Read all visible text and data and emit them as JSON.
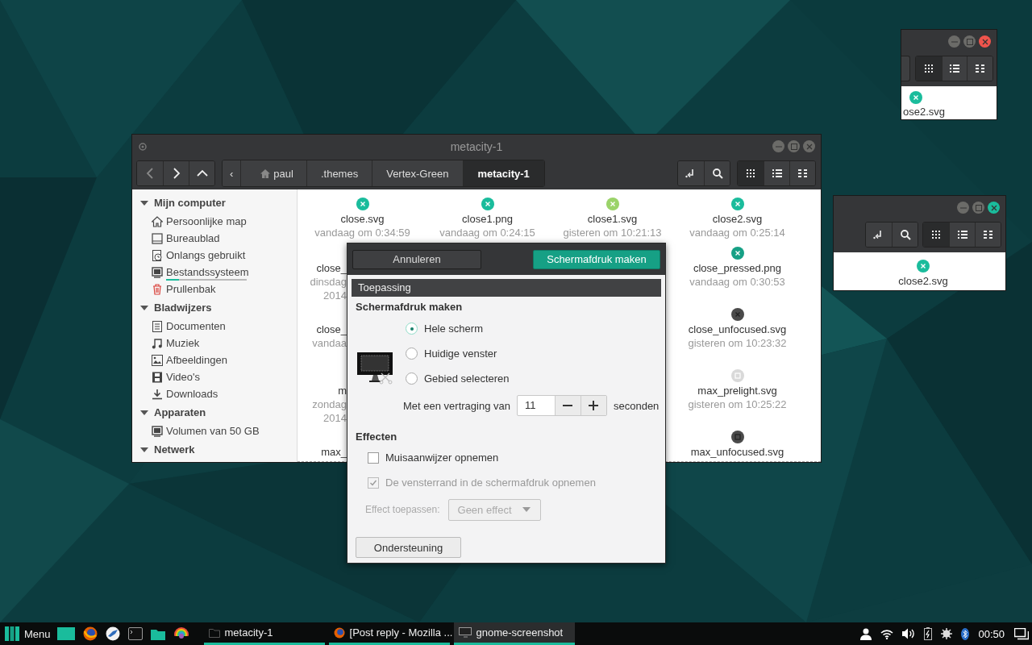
{
  "file_manager": {
    "title": "metacity-1",
    "breadcrumbs": [
      {
        "label": "‹",
        "kind": "scroll",
        "selected": false
      },
      {
        "label": "paul",
        "kind": "home",
        "selected": false
      },
      {
        "label": ".themes",
        "kind": "folder",
        "selected": false
      },
      {
        "label": "Vertex-Green",
        "kind": "folder",
        "selected": false
      },
      {
        "label": "metacity-1",
        "kind": "folder",
        "selected": true
      }
    ],
    "view_modes": [
      {
        "kind": "icons",
        "selected": true
      },
      {
        "kind": "list",
        "selected": false
      },
      {
        "kind": "compact",
        "selected": false
      }
    ],
    "sidebar": [
      {
        "title": "Mijn computer",
        "expanded": true,
        "items": [
          {
            "label": "Persoonlijke map",
            "kind": "home"
          },
          {
            "label": "Bureaublad",
            "kind": "desktop"
          },
          {
            "label": "Onlangs gebruikt",
            "kind": "recent"
          },
          {
            "label": "Bestandssysteem",
            "kind": "drive",
            "usage": {
              "level": 0.16
            }
          },
          {
            "label": "Prullenbak",
            "kind": "trash"
          }
        ]
      },
      {
        "title": "Bladwijzers",
        "expanded": true,
        "items": [
          {
            "label": "Documenten",
            "kind": "documents"
          },
          {
            "label": "Muziek",
            "kind": "music"
          },
          {
            "label": "Afbeeldingen",
            "kind": "pictures"
          },
          {
            "label": "Video's",
            "kind": "video"
          },
          {
            "label": "Downloads",
            "kind": "download"
          }
        ]
      },
      {
        "title": "Apparaten",
        "expanded": true,
        "items": [
          {
            "label": "Volumen van 50 GB",
            "kind": "drive"
          }
        ]
      },
      {
        "title": "Netwerk",
        "expanded": true
      }
    ],
    "files": [
      {
        "name": "close.svg",
        "date": "vandaag om 0:34:59",
        "kind": "close",
        "color": "#1abc9c"
      },
      {
        "name": "close1.png",
        "date": "vandaag om 0:24:15",
        "kind": "close",
        "color": "#1abc9c"
      },
      {
        "name": "close1.svg",
        "date": "gisteren om 10:21:13",
        "kind": "close",
        "color": "#9bd36a"
      },
      {
        "name": "close2.svg",
        "date": "vandaag om 0:25:14",
        "kind": "close",
        "color": "#1abc9c"
      }
    ],
    "more_rows": [
      {
        "left": {
          "lines": [
            "close_",
            "dinsdag",
            "2014"
          ]
        },
        "right": {
          "name": "close_pressed.png",
          "date": "vandaag om 0:30:53",
          "kind": "close",
          "color": "#16a085"
        }
      },
      {
        "left": {
          "lines": [
            "close_",
            "vandaa"
          ]
        },
        "right": {
          "name": "close_unfocused.svg",
          "date": "gisteren om 10:23:32",
          "kind": "close",
          "color": "#4a4a4a"
        }
      },
      {
        "left": {
          "lines": [
            "m",
            "zondag",
            "2014"
          ]
        },
        "right": {
          "name": "max_prelight.svg",
          "date": "gisteren om 10:25:22",
          "kind": "max",
          "color": "#d9d9d9"
        }
      },
      {
        "left": {
          "lines": [
            "max_"
          ]
        },
        "right": {
          "name": "max_unfocused.svg",
          "kind": "max",
          "color": "#4a4a4a"
        }
      }
    ]
  },
  "dialog": {
    "cancel": "Annuleren",
    "confirm": "Schermafdruk maken",
    "header": "Toepassing",
    "section": "Schermafdruk maken",
    "modes": [
      {
        "label": "Hele scherm",
        "selected": true
      },
      {
        "label": "Huidige venster",
        "selected": false
      },
      {
        "label": "Gebied selecteren",
        "selected": false
      }
    ],
    "delay": {
      "label": "Met een vertraging van",
      "value": "11",
      "unit": "seconden"
    },
    "effects_title": "Effecten",
    "options": [
      {
        "label": "Muisaanwijzer opnemen",
        "checked": false,
        "disabled": false
      },
      {
        "label": "De vensterrand in de schermafdruk opnemen",
        "checked": true,
        "disabled": true
      }
    ],
    "effect": {
      "label": "Effect toepassen:",
      "value": "Geen effect",
      "disabled": true
    },
    "help": "Ondersteuning"
  },
  "preview_windows": [
    {
      "close_button": {
        "color": "#f0544c"
      },
      "file": "ose2.svg",
      "search_tools": false,
      "view_modes": [
        {
          "selected": true
        },
        {
          "selected": false
        },
        {
          "selected": false
        }
      ]
    },
    {
      "close_button": {
        "color": "#1abc9c"
      },
      "file": "close2.svg",
      "search_tools": true,
      "view_modes": [
        {
          "selected": true
        },
        {
          "selected": false
        },
        {
          "selected": false
        }
      ]
    }
  ],
  "taskbar": {
    "menu": "Menu",
    "launchers": [
      {
        "kind": "desktop"
      },
      {
        "kind": "firefox"
      },
      {
        "kind": "mail"
      },
      {
        "kind": "terminal"
      },
      {
        "kind": "files"
      },
      {
        "kind": "rainbow"
      }
    ],
    "tasks": [
      {
        "label": "metacity-1",
        "kind": "folder",
        "selected": false
      },
      {
        "label": "[Post reply - Mozilla ...",
        "kind": "firefox",
        "selected": false
      },
      {
        "label": "gnome-screenshot",
        "kind": "screen",
        "selected": true
      }
    ],
    "tray": [
      {
        "kind": "user"
      },
      {
        "kind": "wifi"
      },
      {
        "kind": "volume"
      },
      {
        "kind": "battery"
      },
      {
        "kind": "brightness"
      },
      {
        "kind": "bluetooth"
      }
    ],
    "clock": "00:50"
  }
}
